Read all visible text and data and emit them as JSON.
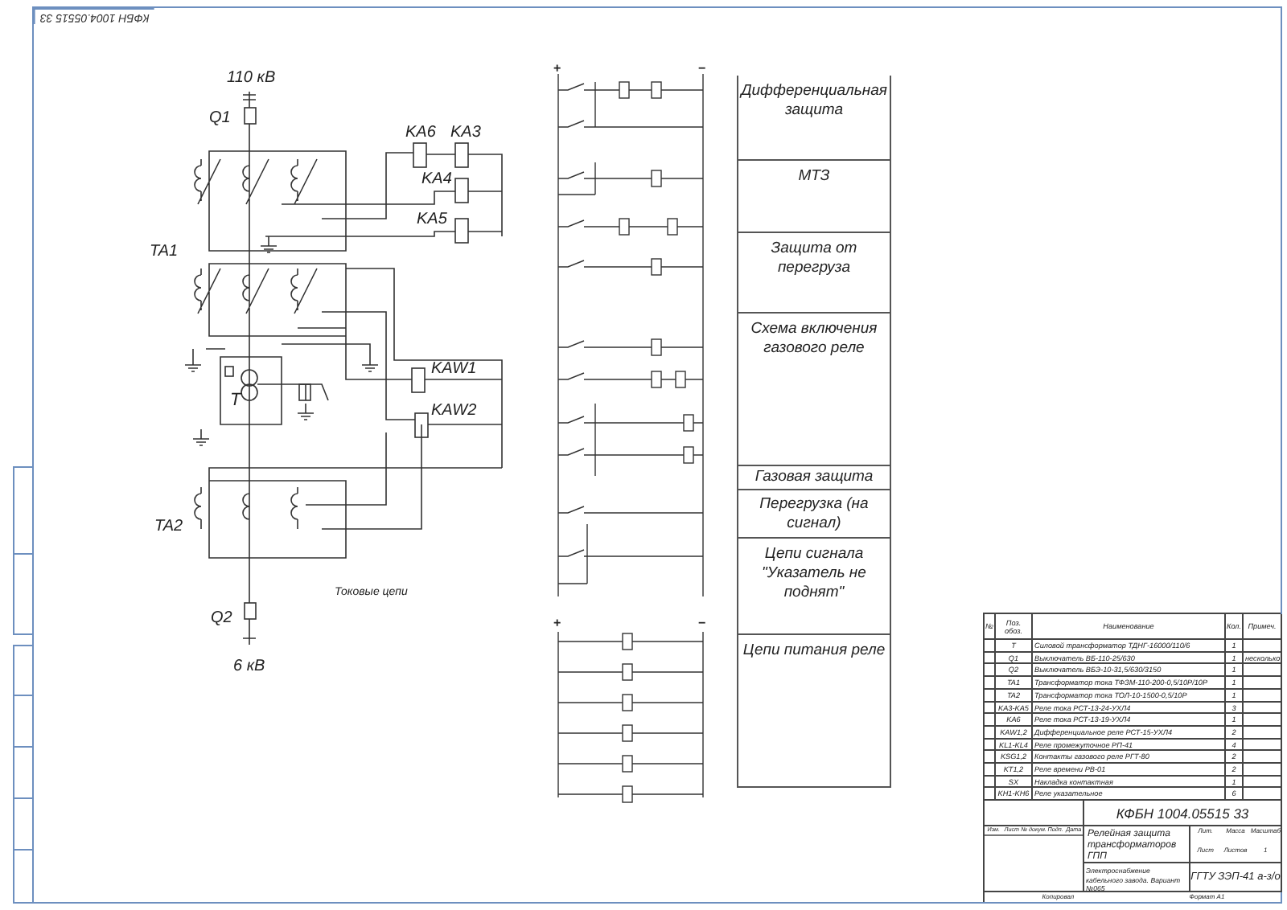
{
  "stamp": "КФБН 1004.05515 33",
  "schematic": {
    "labels": [
      "110 кВ",
      "Q1",
      "KA6",
      "KA3",
      "KA4",
      "KA5",
      "TA1",
      "KAW1",
      "KAW2",
      "T",
      "TA2",
      "Q2",
      "6 кВ"
    ],
    "caption": "Токовые цепи"
  },
  "ladders": [
    {
      "polarity": [
        "+",
        "−"
      ]
    },
    {
      "polarity": [
        "+",
        "−"
      ]
    }
  ],
  "sections": [
    "Дифференциальная защита",
    "МТЗ",
    "Защита от перегруза",
    "Схема включения газового реле",
    "Газовая защита",
    "Перегрузка (на сигнал)",
    "Цепи сигнала \"Указатель не поднят\"",
    "Цепи питания реле"
  ],
  "spec_table": {
    "columns": [
      "№",
      "Поз. обоз.",
      "Наименование",
      "Кол.",
      "Примеч."
    ],
    "rows": [
      [
        "",
        "T",
        "Силовой трансформатор ТДНГ-16000/110/6",
        "1",
        ""
      ],
      [
        "",
        "Q1",
        "Выключатель ВБ-110-25/630",
        "1",
        "несколько"
      ],
      [
        "",
        "Q2",
        "Выключатель ВБЭ-10-31,5/630/3150",
        "1",
        ""
      ],
      [
        "",
        "TA1",
        "Трансформатор тока ТФЗМ-110-200-0,5/10Р/10Р",
        "1",
        ""
      ],
      [
        "",
        "TA2",
        "Трансформатор тока ТОЛ-10-1500-0,5/10Р",
        "1",
        ""
      ],
      [
        "",
        "KA3-KA5",
        "Реле тока РСТ-13-24-УХЛ4",
        "3",
        ""
      ],
      [
        "",
        "KA6",
        "Реле тока РСТ-13-19-УХЛ4",
        "1",
        ""
      ],
      [
        "",
        "KAW1,2",
        "Дифференциальное реле РСТ-15-УХЛ4",
        "2",
        ""
      ],
      [
        "",
        "KL1-KL4",
        "Реле промежуточное РП-41",
        "4",
        ""
      ],
      [
        "",
        "KSG1,2",
        "Контакты газового реле РГТ-80",
        "2",
        ""
      ],
      [
        "",
        "KT1,2",
        "Реле времени РВ-01",
        "2",
        ""
      ],
      [
        "",
        "SX",
        "Накладка контактная",
        "1",
        ""
      ],
      [
        "",
        "KH1-KH6",
        "Реле указательное",
        "6",
        ""
      ]
    ]
  },
  "title_block": {
    "designation": "КФБН 1004.05515 33",
    "signature_headers": [
      "Изм.",
      "Лист",
      "№ докум.",
      "Подп.",
      "Дата"
    ],
    "title": "Релейная защита трансформаторов ГПП",
    "subtitle": "Электроснабжение кабельного завода. Вариант №065",
    "info_headers": [
      "Лит.",
      "Масса",
      "Масштаб"
    ],
    "sheet_headers": [
      "Лист",
      "Листов",
      "1"
    ],
    "group": "ГГТУ ЗЭП-41 а-з/о",
    "footer": [
      "Копировал",
      "Формат А1"
    ]
  }
}
